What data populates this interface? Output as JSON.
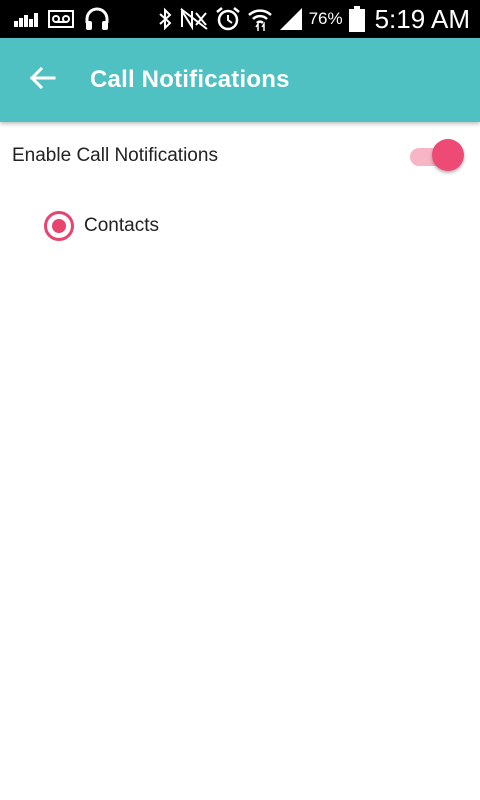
{
  "status_bar": {
    "battery_percent": "76%",
    "time": "5:19 AM",
    "icons": [
      "signal-bars-icon",
      "voicemail-icon",
      "headphones-icon",
      "bluetooth-icon",
      "nfc-muted-icon",
      "alarm-icon",
      "wifi-icon",
      "cell-signal-icon",
      "battery-icon"
    ]
  },
  "app_bar": {
    "title": "Call Notifications",
    "background": "#4fc1c3"
  },
  "settings": {
    "enable_label": "Enable Call Notifications",
    "enable_on": true,
    "accent": "#ee4a76",
    "option_label": "Contacts",
    "option_selected": true
  }
}
